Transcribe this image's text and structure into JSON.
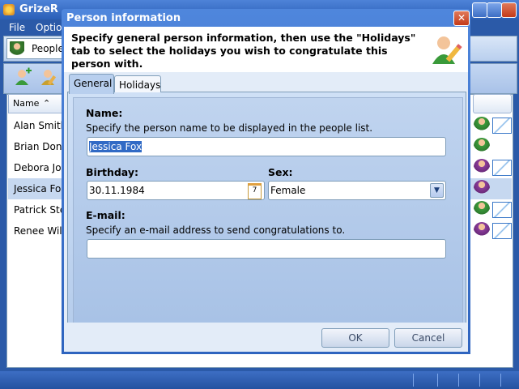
{
  "main": {
    "title": "GrizeR",
    "menu": [
      "File",
      "Optio"
    ],
    "tab_label": "People",
    "column_header": "Name",
    "people": [
      "Alan Smith",
      "Brian Dond",
      "Debora Jol",
      "Jessica Fo",
      "Patrick Ste",
      "Renee Wil"
    ]
  },
  "dialog": {
    "title": "Person information",
    "close_glyph": "✕",
    "description": "Specify general person information, then use the \"Holidays\" tab to select the holidays you wish to congratulate this person with.",
    "tabs": {
      "general": "General",
      "holidays": "Holidays"
    },
    "name_label": "Name:",
    "name_hint": "Specify the person name to be displayed in the people list.",
    "name_value": "Jessica Fox",
    "birthday_label": "Birthday:",
    "birthday_value": "30.11.1984",
    "calendar_glyph": "7",
    "sex_label": "Sex:",
    "sex_value": "Female",
    "email_label": "E-mail:",
    "email_hint": "Specify an e-mail address to send congratulations to.",
    "email_value": "",
    "ok_label": "OK",
    "cancel_label": "Cancel"
  },
  "colors": {
    "title_blue": "#2a5fb8",
    "selection": "#316ac5",
    "panel": "#b6cdec"
  }
}
